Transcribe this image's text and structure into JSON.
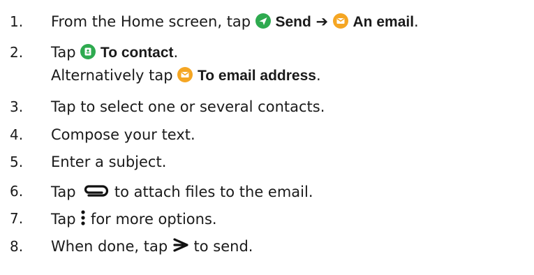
{
  "steps": [
    {
      "number": "1.",
      "parts": {
        "a": "From the Home screen, tap ",
        "b": "Send",
        "c": "An email",
        "d": "."
      }
    },
    {
      "number": "2.",
      "parts": {
        "a": "Tap ",
        "b": "To contact",
        "c": "."
      },
      "alt": {
        "a": "Alternatively tap ",
        "b": "To email address",
        "c": "."
      }
    },
    {
      "number": "3.",
      "text": "Tap to select one or several contacts."
    },
    {
      "number": "4.",
      "text": "Compose your text."
    },
    {
      "number": "5.",
      "text": "Enter a subject."
    },
    {
      "number": "6.",
      "parts": {
        "a": "Tap ",
        "b": " to attach files to the email."
      }
    },
    {
      "number": "7.",
      "parts": {
        "a": "Tap ",
        "b": " for more options."
      }
    },
    {
      "number": "8.",
      "parts": {
        "a": "When done, tap ",
        "b": " to send."
      }
    }
  ],
  "icons": {
    "send": "send-icon",
    "email": "email-icon",
    "contact": "contact-icon",
    "arrow": "arrow-right-icon",
    "attach": "paperclip-icon",
    "more": "more-options-icon",
    "send_action": "send-arrow-icon"
  },
  "colors": {
    "green": "#2eaa4f",
    "orange": "#f5a623"
  }
}
